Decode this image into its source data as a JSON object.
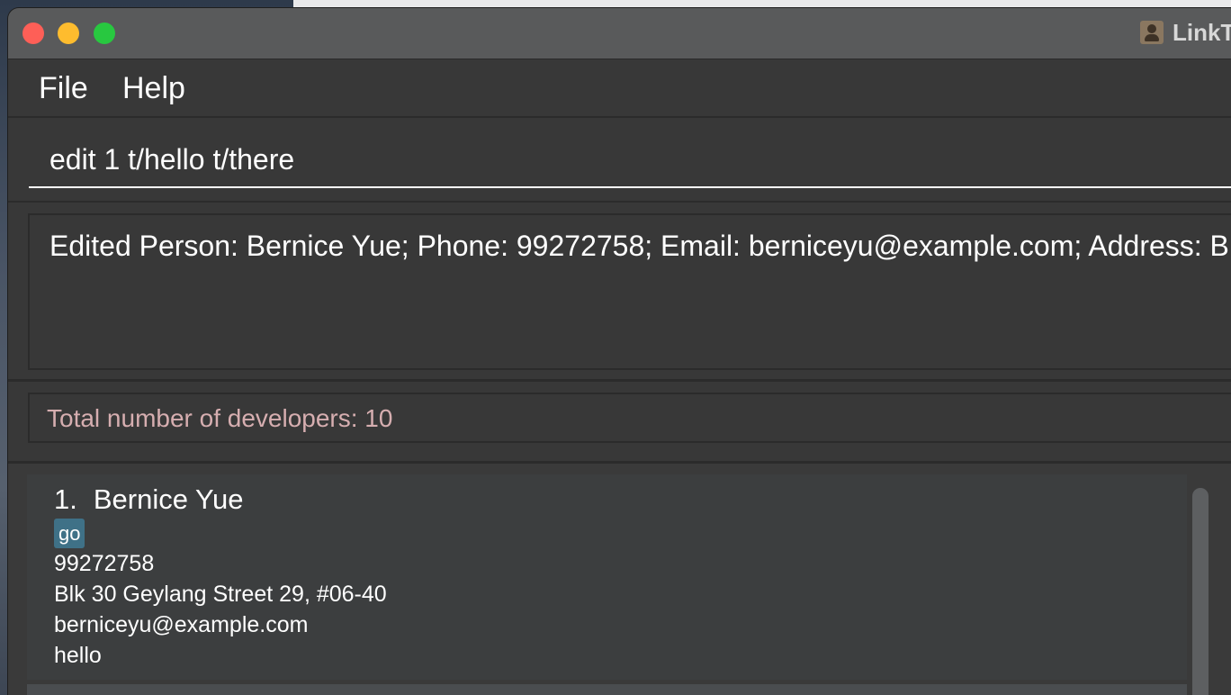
{
  "window": {
    "title": "LinkT"
  },
  "menu": {
    "file": "File",
    "help": "Help"
  },
  "command": {
    "value": "edit 1 t/hello t/there"
  },
  "result": {
    "text": "Edited Person: Bernice Yue; Phone: 99272758; Email: berniceyu@example.com; Address: B"
  },
  "status": {
    "count_text": "Total number of developers: 10"
  },
  "persons": [
    {
      "index": "1.",
      "name": "Bernice Yue",
      "tag": "go",
      "phone": "99272758",
      "address": "Blk 30 Geylang Street 29, #06-40",
      "email": "berniceyu@example.com",
      "note": "hello"
    }
  ],
  "icons": {
    "app": "contact-book-icon"
  }
}
